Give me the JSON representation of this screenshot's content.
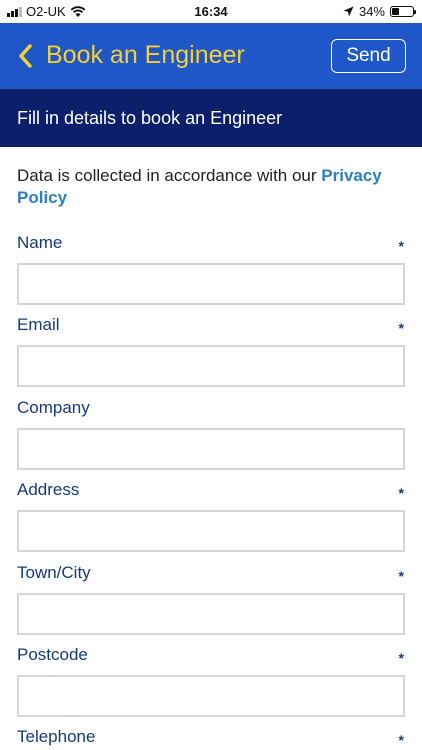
{
  "status_bar": {
    "carrier": "O2-UK",
    "time": "16:34",
    "battery_text": "34%",
    "battery_level": 0.34
  },
  "navbar": {
    "back_icon": "chevron-left-icon",
    "title": "Book an Engineer",
    "send_label": "Send",
    "accent_color": "#f5cf33",
    "background_color": "#1f56c8"
  },
  "subheader": {
    "text": "Fill in details to book an Engineer",
    "background_color": "#0c1f6b"
  },
  "notice": {
    "text": "Data is collected in accordance with our ",
    "link_text": "Privacy Policy"
  },
  "form": {
    "required_marker": "*",
    "fields": [
      {
        "label": "Name",
        "value": "",
        "required": true
      },
      {
        "label": "Email",
        "value": "",
        "required": true
      },
      {
        "label": "Company",
        "value": "",
        "required": false
      },
      {
        "label": "Address",
        "value": "",
        "required": true
      },
      {
        "label": "Town/City",
        "value": "",
        "required": true
      },
      {
        "label": "Postcode",
        "value": "",
        "required": true
      },
      {
        "label": "Telephone",
        "value": "",
        "required": true
      }
    ]
  }
}
